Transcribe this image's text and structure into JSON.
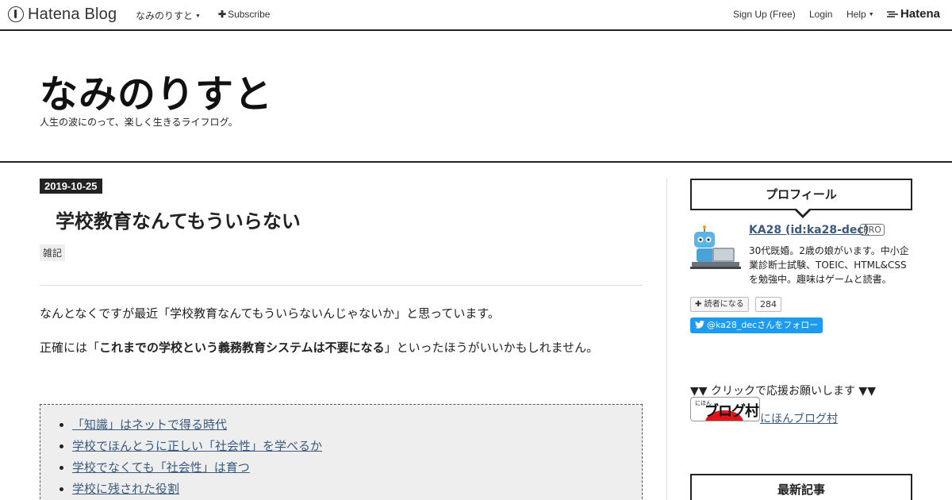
{
  "globalbar": {
    "logo_text": "Hatena Blog",
    "blog_menu_label": "なみのりすと",
    "subscribe_label": "Subscribe",
    "signup_label": "Sign Up (Free)",
    "login_label": "Login",
    "help_label": "Help",
    "brand_label": "Hatena"
  },
  "header": {
    "title": "なみのりすと",
    "description": "人生の波にのって、楽しく生きるライフログ。"
  },
  "entry": {
    "date": "2019-10-25",
    "title": "学校教育なんてもういらない",
    "category": "雑記",
    "paragraph1": "なんとなくですが最近「学校教育なんてもういらないんじゃないか」と思っています。",
    "paragraph2_before": "正確には「",
    "paragraph2_bold": "これまでの学校という義務教育システムは不要になる",
    "paragraph2_after": "」といったほうがいいかもしれません。",
    "toc": [
      "「知識」はネットで得る時代",
      "学校でほんとうに正しい「社会性」を学べるか",
      "学校でなくても「社会性」は育つ",
      "学校に残された役割"
    ]
  },
  "sidebar": {
    "profile_title": "プロフィール",
    "profile_name": "KA28 (id:ka28-dec)",
    "pro_badge": "PRO",
    "profile_desc": "30代既婚。2歳の娘がいます。中小企業診断士試験、TOEIC、HTML&CSSを勉強中。趣味はゲームと読書。",
    "reader_label": "読者になる",
    "reader_count": "284",
    "twitter_label": "@ka28_decさんをフォロー",
    "support_text": "▼▼ クリックで応援お願いします ▼▼",
    "banner_small": "にほん",
    "banner_big": "ブログ村",
    "village_link": "にほんブログ村",
    "recent_title": "最新記事"
  },
  "colors": {
    "link": "#3a5a80",
    "twitter": "#1d9bf0",
    "date_badge": "#222222"
  }
}
